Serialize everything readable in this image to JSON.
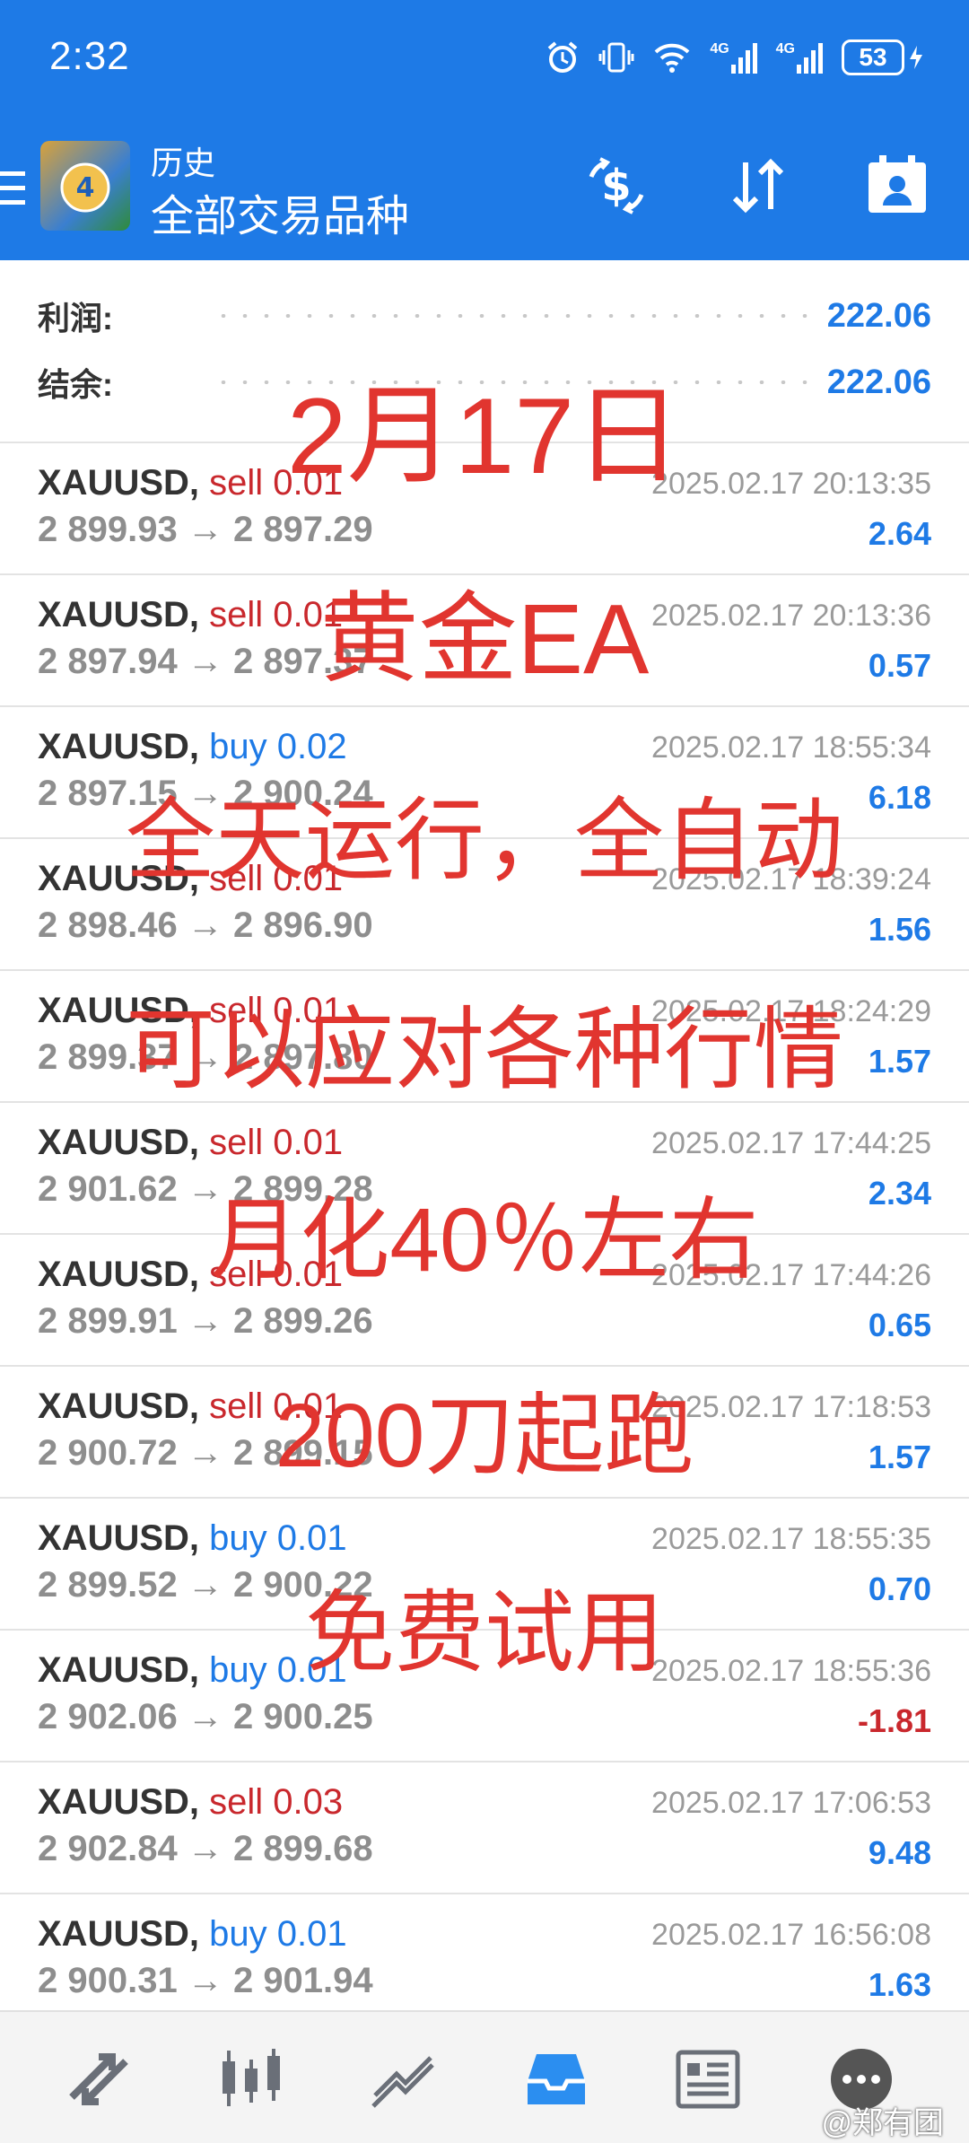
{
  "status": {
    "time": "2:32",
    "battery": "53",
    "net1": "4G",
    "net2": "4G"
  },
  "header": {
    "subtitle": "历史",
    "title": "全部交易品种",
    "icons": [
      "menu-icon",
      "currency-exchange-icon",
      "sort-icon",
      "calendar-person-icon"
    ]
  },
  "summary": {
    "profit_label": "利润:",
    "profit_value": "222.06",
    "balance_label": "结余:",
    "balance_value": "222.06"
  },
  "trades": [
    {
      "symbol": "XAUUSD,",
      "type": "sell",
      "volume": "0.01",
      "open": "2 899.93",
      "close": "2 897.29",
      "time": "2025.02.17 20:13:35",
      "profit": "2.64"
    },
    {
      "symbol": "XAUUSD,",
      "type": "sell",
      "volume": "0.01",
      "open": "2 897.94",
      "close": "2 897.37",
      "time": "2025.02.17 20:13:36",
      "profit": "0.57"
    },
    {
      "symbol": "XAUUSD,",
      "type": "buy",
      "volume": "0.02",
      "open": "2 897.15",
      "close": "2 900.24",
      "time": "2025.02.17 18:55:34",
      "profit": "6.18"
    },
    {
      "symbol": "XAUUSD,",
      "type": "sell",
      "volume": "0.01",
      "open": "2 898.46",
      "close": "2 896.90",
      "time": "2025.02.17 18:39:24",
      "profit": "1.56"
    },
    {
      "symbol": "XAUUSD,",
      "type": "sell",
      "volume": "0.01",
      "open": "2 899.37",
      "close": "2 897.80",
      "time": "2025.02.17 18:24:29",
      "profit": "1.57"
    },
    {
      "symbol": "XAUUSD,",
      "type": "sell",
      "volume": "0.01",
      "open": "2 901.62",
      "close": "2 899.28",
      "time": "2025.02.17 17:44:25",
      "profit": "2.34"
    },
    {
      "symbol": "XAUUSD,",
      "type": "sell",
      "volume": "0.01",
      "open": "2 899.91",
      "close": "2 899.26",
      "time": "2025.02.17 17:44:26",
      "profit": "0.65"
    },
    {
      "symbol": "XAUUSD,",
      "type": "sell",
      "volume": "0.01",
      "open": "2 900.72",
      "close": "2 899.15",
      "time": "2025.02.17 17:18:53",
      "profit": "1.57"
    },
    {
      "symbol": "XAUUSD,",
      "type": "buy",
      "volume": "0.01",
      "open": "2 899.52",
      "close": "2 900.22",
      "time": "2025.02.17 18:55:35",
      "profit": "0.70"
    },
    {
      "symbol": "XAUUSD,",
      "type": "buy",
      "volume": "0.01",
      "open": "2 902.06",
      "close": "2 900.25",
      "time": "2025.02.17 18:55:36",
      "profit": "-1.81"
    },
    {
      "symbol": "XAUUSD,",
      "type": "sell",
      "volume": "0.03",
      "open": "2 902.84",
      "close": "2 899.68",
      "time": "2025.02.17 17:06:53",
      "profit": "9.48"
    },
    {
      "symbol": "XAUUSD,",
      "type": "buy",
      "volume": "0.01",
      "open": "2 900.31",
      "close": "2 901.94",
      "time": "2025.02.17 16:56:08",
      "profit": "1.63"
    }
  ],
  "overlay": [
    "2月17日",
    "黄金EA",
    "全天运行，全自动",
    "可以应对各种行情",
    "月化40％左右",
    "200刀起跑",
    "免费试用"
  ],
  "bottom_nav": [
    "quotes-icon",
    "chart-icon",
    "trade-icon",
    "history-icon",
    "news-icon",
    "messages-icon"
  ],
  "watermark": "@郑有团",
  "colors": {
    "header_blue": "#1e7ae6",
    "sell_red": "#c9282d",
    "buy_blue": "#1e7ae6",
    "overlay_red": "#e1352f"
  }
}
